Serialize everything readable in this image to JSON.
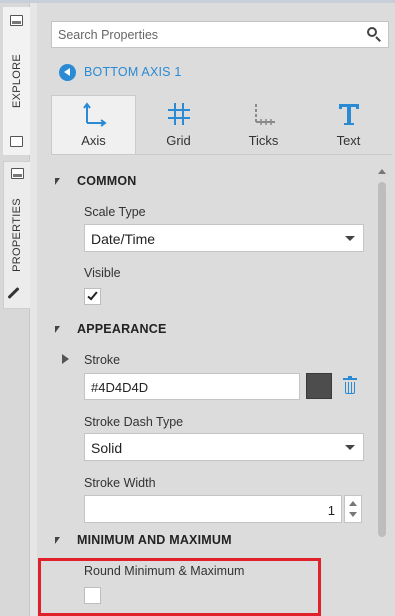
{
  "sidebar": {
    "tabs": [
      {
        "label": "EXPLORE"
      },
      {
        "label": "PROPERTIES"
      }
    ]
  },
  "search": {
    "placeholder": "Search Properties"
  },
  "breadcrumb": {
    "label": "BOTTOM AXIS 1"
  },
  "tabs": [
    {
      "label": "Axis",
      "icon": "axis-icon",
      "active": true
    },
    {
      "label": "Grid",
      "icon": "grid-icon",
      "active": false
    },
    {
      "label": "Ticks",
      "icon": "ticks-icon",
      "active": false
    },
    {
      "label": "Text",
      "icon": "text-icon",
      "active": false
    }
  ],
  "sections": {
    "common": {
      "title": "COMMON",
      "scale_type_label": "Scale Type",
      "scale_type_value": "Date/Time",
      "visible_label": "Visible",
      "visible_checked": true
    },
    "appearance": {
      "title": "APPEARANCE",
      "stroke_label": "Stroke",
      "stroke_value": "#4D4D4D",
      "stroke_dash_label": "Stroke Dash Type",
      "stroke_dash_value": "Solid",
      "stroke_width_label": "Stroke Width",
      "stroke_width_value": "1"
    },
    "minmax": {
      "title": "MINIMUM AND MAXIMUM",
      "round_label": "Round Minimum & Maximum",
      "round_checked": false
    }
  },
  "colors": {
    "accent": "#2a8ad4",
    "stroke_swatch": "#4D4D4D",
    "highlight": "#e0202b"
  }
}
